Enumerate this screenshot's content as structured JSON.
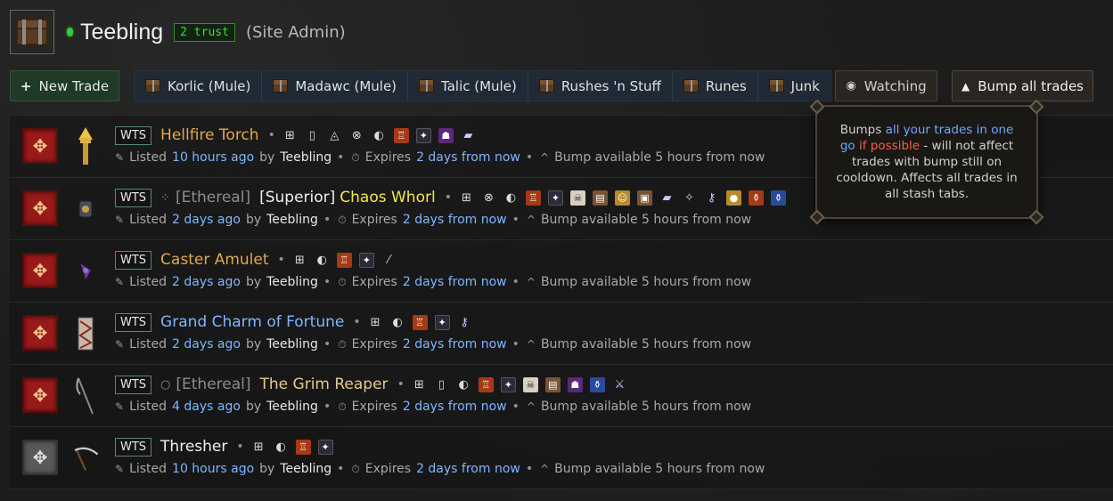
{
  "header": {
    "avatar_icon": "chest-icon",
    "status": "online",
    "username": "Teebling",
    "trust": "2 trust",
    "role": "(Site Admin)"
  },
  "toolbar": {
    "new_trade": "New Trade",
    "tabs": [
      {
        "label": "Korlic (Mule)"
      },
      {
        "label": "Madawc (Mule)"
      },
      {
        "label": "Talic (Mule)"
      },
      {
        "label": "Rushes 'n Stuff"
      },
      {
        "label": "Runes"
      },
      {
        "label": "Junk"
      }
    ],
    "watching": "Watching",
    "bump_all": "Bump all trades"
  },
  "tooltip": {
    "t1": "Bumps ",
    "t2": "all your trades in one go",
    "t3": " ",
    "t4": "if possible",
    "t5": " - will not affect trades with bump still on cooldown. Affects all trades in all stash tabs."
  },
  "trades": [
    {
      "tag": "WTS",
      "ethereal": "",
      "prefix": "",
      "name": "Hellfire Torch",
      "name_color": "gold",
      "listed": "10 hours ago",
      "user": "Teebling",
      "expires": "2 days from now",
      "bump": "Bump available 5 hours from now"
    },
    {
      "tag": "WTS",
      "ethereal": "[Ethereal]",
      "prefix": "[Superior]",
      "name": "Chaos Whorl",
      "name_color": "yellow",
      "listed": "2 days ago",
      "user": "Teebling",
      "expires": "2 days from now",
      "bump": "Bump available 5 hours from now"
    },
    {
      "tag": "WTS",
      "ethereal": "",
      "prefix": "",
      "name": "Caster Amulet",
      "name_color": "gold",
      "listed": "2 days ago",
      "user": "Teebling",
      "expires": "2 days from now",
      "bump": "Bump available 5 hours from now"
    },
    {
      "tag": "WTS",
      "ethereal": "",
      "prefix": "",
      "name": "Grand Charm of Fortune",
      "name_color": "blue",
      "listed": "2 days ago",
      "user": "Teebling",
      "expires": "2 days from now",
      "bump": "Bump available 5 hours from now"
    },
    {
      "tag": "WTS",
      "ethereal": "[Ethereal]",
      "prefix": "",
      "name": "The Grim Reaper",
      "name_color": "tan",
      "listed": "4 days ago",
      "user": "Teebling",
      "expires": "2 days from now",
      "bump": "Bump available 5 hours from now"
    },
    {
      "tag": "WTS",
      "ethereal": "",
      "prefix": "",
      "name": "Thresher",
      "name_color": "white",
      "listed": "10 hours ago",
      "user": "Teebling",
      "expires": "2 days from now",
      "bump": "Bump available 5 hours from now"
    }
  ],
  "labels": {
    "listed": "Listed",
    "by": "by",
    "expires": "Expires"
  }
}
